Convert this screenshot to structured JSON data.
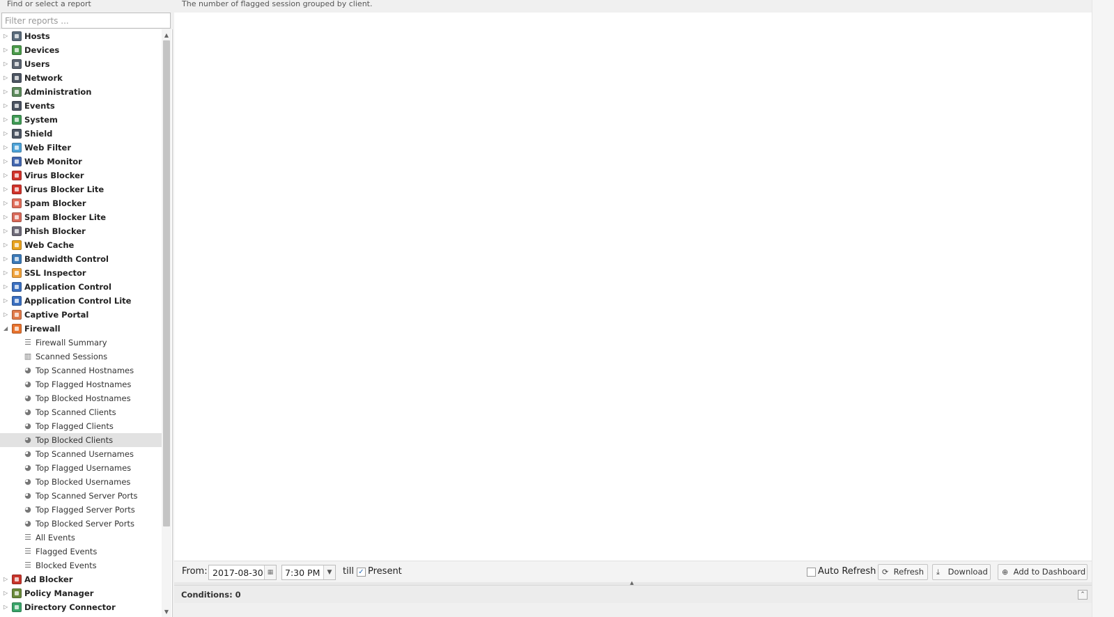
{
  "left_panel": {
    "title": "Find or select a report",
    "filter_placeholder": "Filter reports ...",
    "categories_top": [
      {
        "label": "Hosts",
        "icon": "hosts-icon",
        "color": "#5a6b7b"
      },
      {
        "label": "Devices",
        "icon": "devices-icon",
        "color": "#4a9a4a"
      },
      {
        "label": "Users",
        "icon": "users-icon",
        "color": "#5b6470"
      },
      {
        "label": "Network",
        "icon": "network-icon",
        "color": "#4c5562"
      },
      {
        "label": "Administration",
        "icon": "administration-icon",
        "color": "#5c8a5c"
      },
      {
        "label": "Events",
        "icon": "events-icon",
        "color": "#4a5260"
      },
      {
        "label": "System",
        "icon": "system-icon",
        "color": "#3f9a55"
      },
      {
        "label": "Shield",
        "icon": "shield-icon",
        "color": "#4d5663"
      },
      {
        "label": "Web Filter",
        "icon": "web-filter-icon",
        "color": "#4ea3d8"
      },
      {
        "label": "Web Monitor",
        "icon": "web-monitor-icon",
        "color": "#4468b0"
      },
      {
        "label": "Virus Blocker",
        "icon": "virus-blocker-icon",
        "color": "#d0332b"
      },
      {
        "label": "Virus Blocker Lite",
        "icon": "virus-blocker-lite-icon",
        "color": "#d0332b"
      },
      {
        "label": "Spam Blocker",
        "icon": "spam-blocker-icon",
        "color": "#e06d5a"
      },
      {
        "label": "Spam Blocker Lite",
        "icon": "spam-blocker-lite-icon",
        "color": "#d96a5a"
      },
      {
        "label": "Phish Blocker",
        "icon": "phish-blocker-icon",
        "color": "#6e6a78"
      },
      {
        "label": "Web Cache",
        "icon": "web-cache-icon",
        "color": "#e8a21e"
      },
      {
        "label": "Bandwidth Control",
        "icon": "bandwidth-control-icon",
        "color": "#3b7ab8"
      },
      {
        "label": "SSL Inspector",
        "icon": "ssl-inspector-icon",
        "color": "#f0a23b"
      },
      {
        "label": "Application Control",
        "icon": "application-control-icon",
        "color": "#3a6fc0"
      },
      {
        "label": "Application Control Lite",
        "icon": "application-control-lite-icon",
        "color": "#3a6fc0"
      },
      {
        "label": "Captive Portal",
        "icon": "captive-portal-icon",
        "color": "#e07a4a"
      },
      {
        "label": "Firewall",
        "icon": "firewall-icon",
        "color": "#e8732e"
      }
    ],
    "firewall_reports": [
      {
        "label": "Firewall Summary",
        "icon": "text-lines-icon",
        "glyph": "☰"
      },
      {
        "label": "Scanned Sessions",
        "icon": "bar-chart-icon",
        "glyph": "▥"
      },
      {
        "label": "Top Scanned Hostnames",
        "icon": "pie-chart-icon",
        "glyph": "◕"
      },
      {
        "label": "Top Flagged Hostnames",
        "icon": "pie-chart-icon",
        "glyph": "◕"
      },
      {
        "label": "Top Blocked Hostnames",
        "icon": "pie-chart-icon",
        "glyph": "◕"
      },
      {
        "label": "Top Scanned Clients",
        "icon": "pie-chart-icon",
        "glyph": "◕"
      },
      {
        "label": "Top Flagged Clients",
        "icon": "pie-chart-icon",
        "glyph": "◕"
      },
      {
        "label": "Top Blocked Clients",
        "icon": "pie-chart-icon",
        "glyph": "◕",
        "selected": true
      },
      {
        "label": "Top Scanned Usernames",
        "icon": "pie-chart-icon",
        "glyph": "◕"
      },
      {
        "label": "Top Flagged Usernames",
        "icon": "pie-chart-icon",
        "glyph": "◕"
      },
      {
        "label": "Top Blocked Usernames",
        "icon": "pie-chart-icon",
        "glyph": "◕"
      },
      {
        "label": "Top Scanned Server Ports",
        "icon": "pie-chart-icon",
        "glyph": "◕"
      },
      {
        "label": "Top Flagged Server Ports",
        "icon": "pie-chart-icon",
        "glyph": "◕"
      },
      {
        "label": "Top Blocked Server Ports",
        "icon": "pie-chart-icon",
        "glyph": "◕"
      },
      {
        "label": "All Events",
        "icon": "list-icon",
        "glyph": "☰"
      },
      {
        "label": "Flagged Events",
        "icon": "list-icon",
        "glyph": "☰"
      },
      {
        "label": "Blocked Events",
        "icon": "list-icon",
        "glyph": "☰"
      }
    ],
    "categories_bottom": [
      {
        "label": "Ad Blocker",
        "icon": "ad-blocker-icon",
        "color": "#c8352b"
      },
      {
        "label": "Policy Manager",
        "icon": "policy-manager-icon",
        "color": "#6a8a3a"
      },
      {
        "label": "Directory Connector",
        "icon": "directory-connector-icon",
        "color": "#3aa56a"
      }
    ]
  },
  "report": {
    "description": "The number of flagged session grouped by client."
  },
  "toolbar": {
    "from_label": "From:",
    "date_value": "2017-08-30",
    "time_value": "7:30 PM",
    "till_label": "till",
    "present_label": "Present",
    "present_checked": true,
    "auto_refresh_label": "Auto Refresh",
    "auto_refresh_checked": false,
    "refresh_label": "Refresh",
    "download_label": "Download",
    "add_dashboard_label": "Add to Dashboard"
  },
  "conditions": {
    "label": "Conditions: 0"
  }
}
